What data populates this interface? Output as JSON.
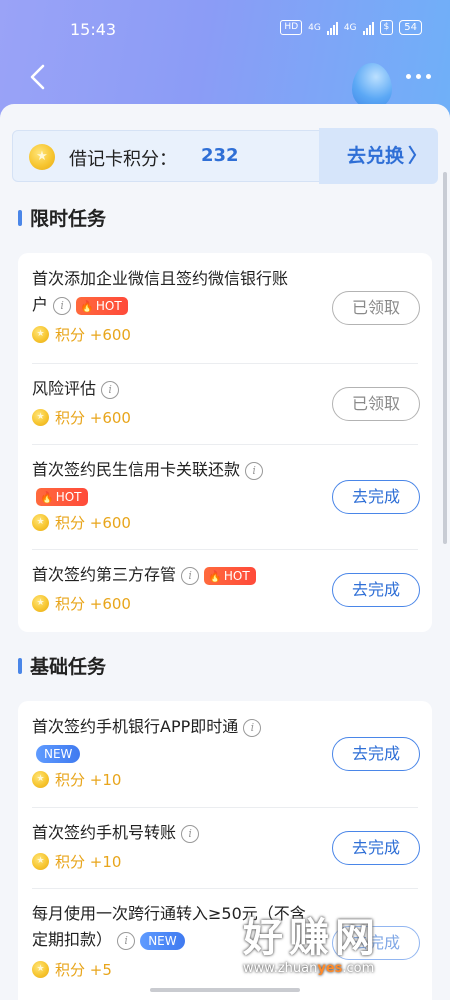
{
  "status_bar": {
    "time": "15:43",
    "hd": "HD",
    "net1": "4G",
    "net2": "4G",
    "battery": "54"
  },
  "header": {
    "back_icon": "chevron-left-icon",
    "more_icon": "more-horizontal-icon"
  },
  "points": {
    "label": "借记卡积分：",
    "value": "232",
    "redeem_label": "去兑换",
    "redeem_chevron": "〉"
  },
  "sections": {
    "limited": {
      "title": "限时任务"
    },
    "basic": {
      "title": "基础任务"
    }
  },
  "tasks": {
    "t1": {
      "title": "首次添加企业微信且签约微信银行账户",
      "line1": "首次添加企业微信且签约微信银行账",
      "line2": "户",
      "hot": "HOT",
      "reward": "积分 +600",
      "action": "已领取",
      "status": "claimed"
    },
    "t2": {
      "title": "风险评估",
      "reward": "积分 +600",
      "action": "已领取",
      "status": "claimed"
    },
    "t3": {
      "title": "首次签约民生信用卡关联还款",
      "hot": "HOT",
      "reward": "积分 +600",
      "action": "去完成",
      "status": "todo"
    },
    "t4": {
      "title": "首次签约第三方存管",
      "hot": "HOT",
      "reward": "积分 +600",
      "action": "去完成",
      "status": "todo"
    },
    "t5": {
      "title": "首次签约手机银行APP即时通",
      "new": "NEW",
      "reward": "积分 +10",
      "action": "去完成",
      "status": "todo"
    },
    "t6": {
      "title": "首次签约手机号转账",
      "reward": "积分 +10",
      "action": "去完成",
      "status": "todo"
    },
    "t7": {
      "line1": "每月使用一次跨行通转入≥50元（不含",
      "line2": "定期扣款）",
      "new": "NEW",
      "reward": "积分 +5",
      "action": "去完成",
      "status": "todo"
    }
  },
  "icons": {
    "info": "i",
    "flame": "🔥",
    "coin": "coin-icon"
  },
  "watermark": {
    "big": "好赚网",
    "url_prefix": "www.zhuan",
    "url_highlight": "yes",
    "url_suffix": ".com"
  },
  "colors": {
    "accent": "#2f6fd6",
    "reward": "#e8a51b",
    "hot": "#ff4a3a",
    "new": "#3f7af0"
  }
}
